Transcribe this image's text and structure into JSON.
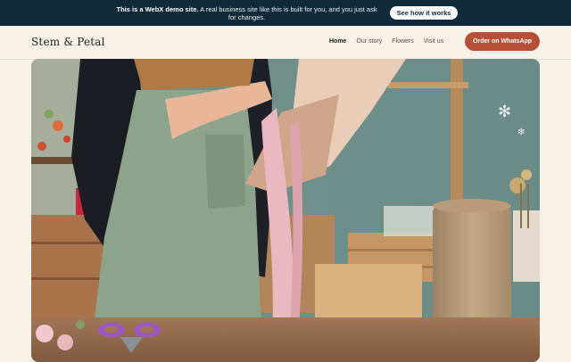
{
  "banner": {
    "bold": "This is a WebX demo site.",
    "text": " A real business site like this is built for you, and you just ask for changes.",
    "button": "See how it works"
  },
  "nav": {
    "logo": "Stem & Petal",
    "links": [
      {
        "label": "Home"
      },
      {
        "label": "Our story"
      },
      {
        "label": "Flowers"
      },
      {
        "label": "Visit us"
      }
    ],
    "cta": "Order on WhatsApp"
  },
  "colors": {
    "banner_bg": "#112a3a",
    "page_bg": "#f8f1e8",
    "cta_bg": "#b54f35",
    "hero_wall": "#6b8d88"
  }
}
